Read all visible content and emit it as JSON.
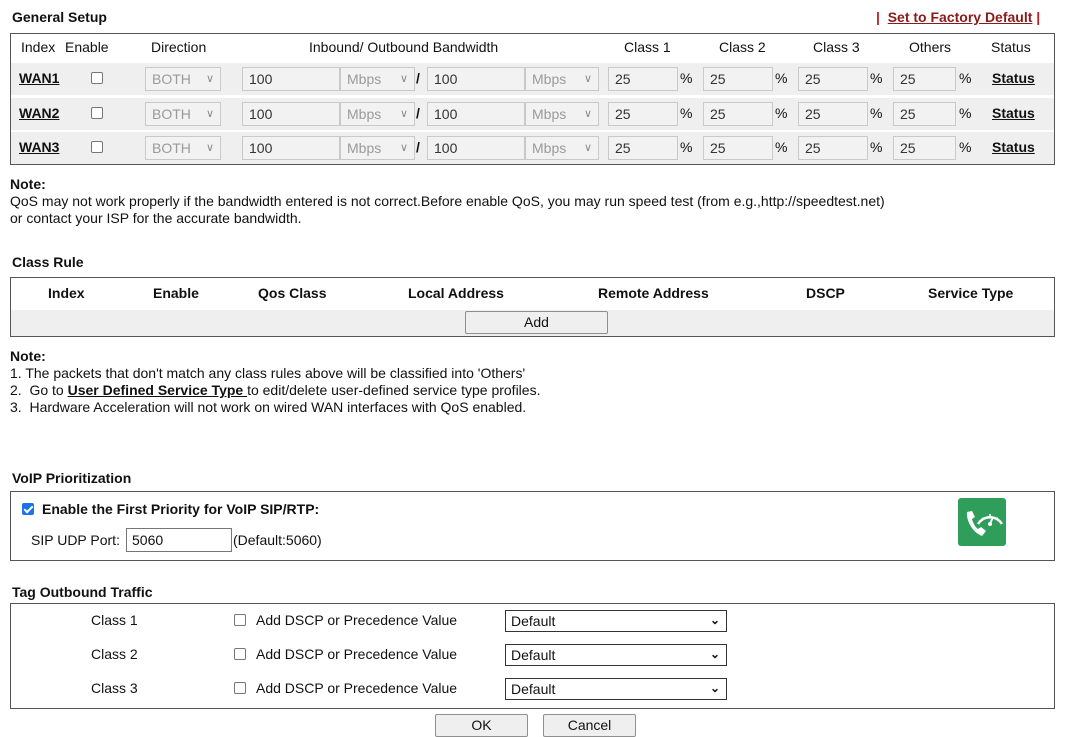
{
  "general_setup": {
    "title": "General Setup",
    "factory_link": "Set to Factory Default",
    "headers": {
      "index": "Index",
      "enable": "Enable",
      "direction": "Direction",
      "bandwidth": "Inbound/ Outbound Bandwidth",
      "class1": "Class 1",
      "class2": "Class 2",
      "class3": "Class 3",
      "others": "Others",
      "status": "Status"
    },
    "rows": [
      {
        "index": "WAN1",
        "direction": "BOTH",
        "inbound": "100",
        "inbound_unit": "Mbps",
        "outbound": "100",
        "outbound_unit": "Mbps",
        "class1": "25",
        "class2": "25",
        "class3": "25",
        "others": "25",
        "status": "Status"
      },
      {
        "index": "WAN2",
        "direction": "BOTH",
        "inbound": "100",
        "inbound_unit": "Mbps",
        "outbound": "100",
        "outbound_unit": "Mbps",
        "class1": "25",
        "class2": "25",
        "class3": "25",
        "others": "25",
        "status": "Status"
      },
      {
        "index": "WAN3",
        "direction": "BOTH",
        "inbound": "100",
        "inbound_unit": "Mbps",
        "outbound": "100",
        "outbound_unit": "Mbps",
        "class1": "25",
        "class2": "25",
        "class3": "25",
        "others": "25",
        "status": "Status"
      }
    ],
    "percent": "%",
    "slash": "/"
  },
  "note1": {
    "label": "Note:",
    "line1": "QoS may not work properly if the bandwidth entered is not correct.Before enable QoS, you may run speed test (from e.g.,http://speedtest.net)",
    "line2": "or contact your ISP for the accurate bandwidth."
  },
  "class_rule": {
    "title": "Class Rule",
    "headers": {
      "index": "Index",
      "enable": "Enable",
      "qos_class": "Qos Class",
      "local_address": "Local Address",
      "remote_address": "Remote Address",
      "dscp": "DSCP",
      "service_type": "Service Type"
    },
    "add_button": "Add"
  },
  "note2": {
    "label": "Note:",
    "item1": "1.  The packets that don't match any class rules above will be classified into 'Others'",
    "item2_pre": "2.  Go to ",
    "item2_link": "User Defined Service Type ",
    "item2_post": "to edit/delete user-defined service type profiles.",
    "item3": "3.  Hardware Acceleration will not work on wired WAN interfaces with QoS enabled."
  },
  "voip": {
    "title": "VoIP Prioritization",
    "enable_label": "Enable the First Priority for VoIP SIP/RTP:",
    "sip_port_label": "SIP UDP Port:",
    "sip_port_value": "5060",
    "default_hint": "(Default:5060)",
    "badge_color": "#2f9e5a"
  },
  "tag_outbound": {
    "title": "Tag Outbound Traffic",
    "rows": [
      {
        "class": "Class 1",
        "checkbox_label": "Add DSCP or Precedence Value",
        "value": "Default"
      },
      {
        "class": "Class 2",
        "checkbox_label": "Add DSCP or Precedence Value",
        "value": "Default"
      },
      {
        "class": "Class 3",
        "checkbox_label": "Add DSCP or Precedence Value",
        "value": "Default"
      }
    ]
  },
  "buttons": {
    "ok": "OK",
    "cancel": "Cancel"
  }
}
